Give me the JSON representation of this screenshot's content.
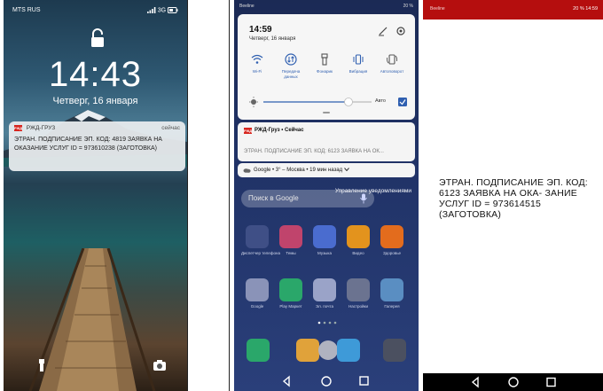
{
  "panels": {
    "lock": {
      "carrier": "MTS RUS",
      "net": "3G",
      "time": "14:43",
      "date": "Четверг, 16 января",
      "notification": {
        "app": "РЖД-ГРУЗ",
        "when": "сейчас",
        "text": "ЭТРАН. ПОДПИСАНИЕ ЭП. КОД: 4819 ЗАЯВКА НА ОКАЗАНИЕ УСЛУГ ID = 973610238 (ЗАГОТОВКА)"
      }
    },
    "shade": {
      "carrier": "Beeline",
      "battery": "20 %",
      "time": "14:59",
      "date": "Четверг, 16 января",
      "tiles": [
        "Wi-Fi",
        "Передача данных",
        "Фонарик",
        "Вибрация",
        "Автоповорот"
      ],
      "auto_label": "Авто",
      "notification": {
        "app": "РЖД-Груз • Сейчас",
        "text": "ЭТРАН. ПОДПИСАНИЕ ЭП. КОД: 6123 ЗАЯВКА НА ОК..."
      },
      "weather": "Google • 3° – Москва • 19 мин назад",
      "manage": "Управление уведомлениями",
      "search_placeholder": "Поиск в Google",
      "apps": [
        "Диспетчер телефона",
        "Темы",
        "Музыка",
        "Видео",
        "Здоровье",
        "Google",
        "Play Маркет",
        "Эл. почта",
        "Настройки",
        "Галерея"
      ]
    },
    "app": {
      "carrier": "Beeline",
      "status_right": "20 % 14:59",
      "message": "ЭТРАН. ПОДПИСАНИЕ ЭП. КОД: 6123 ЗАЯВКА НА ОКА- ЗАНИЕ УСЛУГ ID = 973614515 (ЗАГОТОВКА)"
    }
  },
  "colors": {
    "rzd_red": "#d7261f",
    "app_bar": "#b50e0e",
    "shade_accent": "#2f5fb0"
  }
}
